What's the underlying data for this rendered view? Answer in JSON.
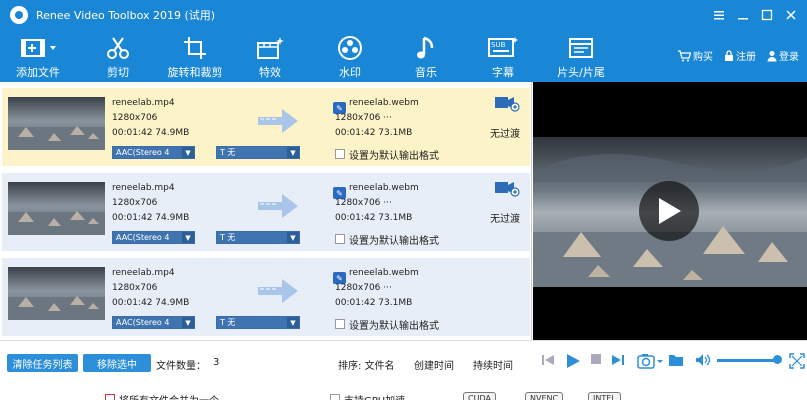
{
  "window": {
    "title": "Renee Video Toolbox 2019 (试用)",
    "controls": [
      "minimize",
      "restore",
      "close"
    ]
  },
  "toolbar": {
    "items": [
      {
        "label": "添加文件",
        "icon": "add-file-icon"
      },
      {
        "label": "剪切",
        "icon": "scissors-icon"
      },
      {
        "label": "旋转和裁剪",
        "icon": "rotate-crop-icon"
      },
      {
        "label": "特效",
        "icon": "effects-icon"
      },
      {
        "label": "水印",
        "icon": "watermark-icon"
      },
      {
        "label": "音乐",
        "icon": "music-icon"
      },
      {
        "label": "字幕",
        "icon": "subtitle-icon"
      },
      {
        "label": "片头/片尾",
        "icon": "intro-outro-icon"
      }
    ],
    "account": {
      "buy": "购买",
      "register": "注册",
      "login": "登录"
    }
  },
  "tasks": [
    {
      "input_name": "reneelab.mp4",
      "input_res": "1280x706",
      "input_meta": "00:01:42  74.9MB",
      "audio": "AAC(Stereo 4",
      "subtitle": "T  无",
      "output_name": "reneelab.webm",
      "output_res": "1280x706    ···",
      "output_meta": "00:01:42  73.1MB",
      "default_format_label": "设置为默认输出格式",
      "transition": "无过渡",
      "selected": true
    },
    {
      "input_name": "reneelab.mp4",
      "input_res": "1280x706",
      "input_meta": "00:01:42  74.9MB",
      "audio": "AAC(Stereo 4",
      "subtitle": "T  无",
      "output_name": "reneelab.webm",
      "output_res": "1280x706    ···",
      "output_meta": "00:01:42  73.1MB",
      "default_format_label": "设置为默认输出格式",
      "transition": "无过渡",
      "selected": false
    },
    {
      "input_name": "reneelab.mp4",
      "input_res": "1280x706",
      "input_meta": "00:01:42  74.9MB",
      "audio": "AAC(Stereo 4",
      "subtitle": "T  无",
      "output_name": "reneelab.webm",
      "output_res": "1280x706    ···",
      "output_meta": "00:01:42  73.1MB",
      "default_format_label": "设置为默认输出格式",
      "transition": "",
      "selected": false
    }
  ],
  "list_controls": {
    "clear_tasks": "清除任务列表",
    "remove_selected": "移除选中",
    "file_count_label": "文件数量：",
    "file_count": "3",
    "sort_label": "排序: 文件名",
    "sort_created": "创建时间",
    "sort_duration": "持续时间"
  },
  "options": {
    "merge_label": "将所有文件合并为一个",
    "gpu_label": "支持GPU加速",
    "badges": [
      "CUDA",
      "NVENC",
      "INTEL"
    ]
  },
  "player": {
    "volume": 0.95
  },
  "colors": {
    "brand_blue": "#1a87d6",
    "selected_row": "#fdf3c8",
    "normal_row": "#e7eef7",
    "accent": "#2d8fd9"
  }
}
